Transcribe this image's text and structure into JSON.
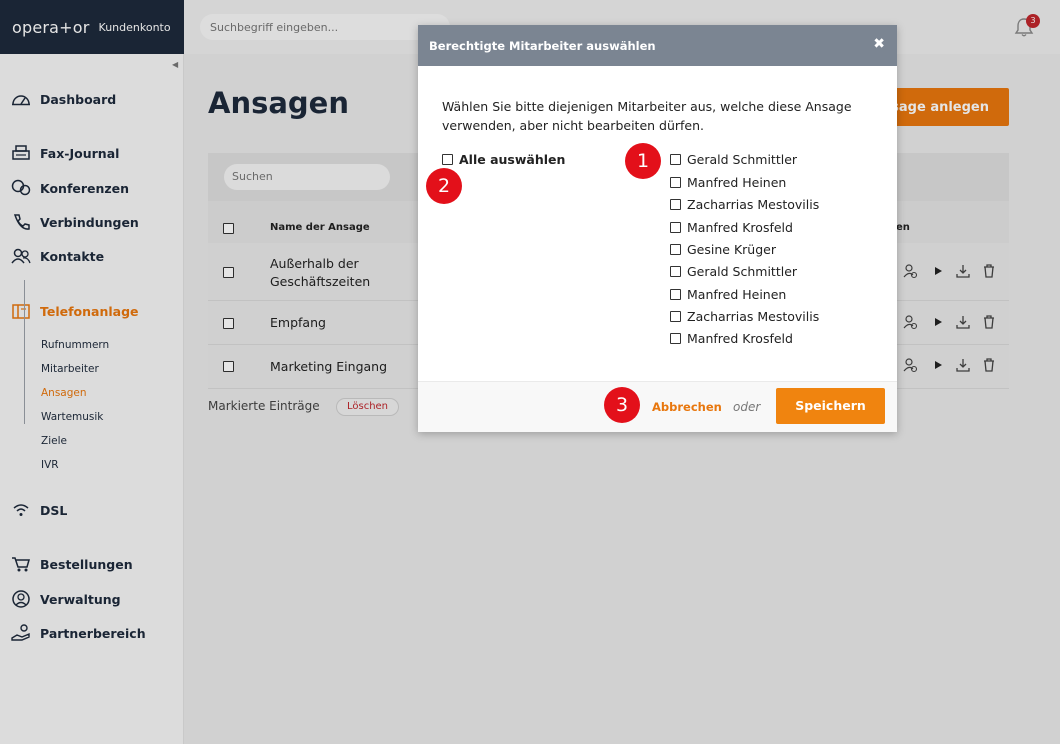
{
  "header": {
    "logo": "opera+or",
    "account_label": "Kundenkonto",
    "search_placeholder": "Suchbegriff eingeben...",
    "notification_count": "3"
  },
  "sidebar": {
    "items": [
      {
        "label": "Dashboard",
        "icon": "dashboard-icon"
      },
      {
        "label": "Fax-Journal",
        "icon": "fax-icon"
      },
      {
        "label": "Konferenzen",
        "icon": "conference-icon"
      },
      {
        "label": "Verbindungen",
        "icon": "phone-icon"
      },
      {
        "label": "Kontakte",
        "icon": "contacts-icon"
      },
      {
        "label": "Telefonanlage",
        "icon": "pbx-icon"
      },
      {
        "label": "DSL",
        "icon": "wifi-icon"
      },
      {
        "label": "Bestellungen",
        "icon": "cart-icon"
      },
      {
        "label": "Verwaltung",
        "icon": "user-circle-icon"
      },
      {
        "label": "Partnerbereich",
        "icon": "partner-icon"
      }
    ],
    "subitems": [
      "Rufnummern",
      "Mitarbeiter",
      "Ansagen",
      "Wartemusik",
      "Ziele",
      "IVR"
    ]
  },
  "main": {
    "title": "Ansagen",
    "new_button": "sage anlegen",
    "search_placeholder": "Suchen",
    "col_name": "Name der Ansage",
    "col_actions": "onen",
    "rows": [
      {
        "name": "Außerhalb der Geschäftszeiten"
      },
      {
        "name": "Empfang"
      },
      {
        "name": "Marketing Eingang"
      }
    ],
    "marked_label": "Markierte Einträge",
    "delete_label": "Löschen"
  },
  "modal": {
    "title": "Berechtigte Mitarbeiter auswählen",
    "close": "✖",
    "description": "Wählen Sie bitte diejenigen Mitarbeiter aus, welche diese Ansage verwenden, aber nicht bearbeiten dürfen.",
    "select_all": "Alle auswählen",
    "employees": [
      "Gerald Schmittler",
      "Manfred Heinen",
      "Zacharrias Mestovilis",
      "Manfred Krosfeld",
      "Gesine Krüger",
      "Gerald Schmittler",
      "Manfred Heinen",
      "Zacharrias Mestovilis",
      "Manfred Krosfeld"
    ],
    "cancel_label": "Abbrechen",
    "or_label": "oder",
    "save_label": "Speichern"
  },
  "markers": [
    "1",
    "2",
    "3"
  ],
  "colors": {
    "accent": "#e8770e",
    "marker": "#e3101a",
    "brand_bg": "#1e2a3b"
  }
}
